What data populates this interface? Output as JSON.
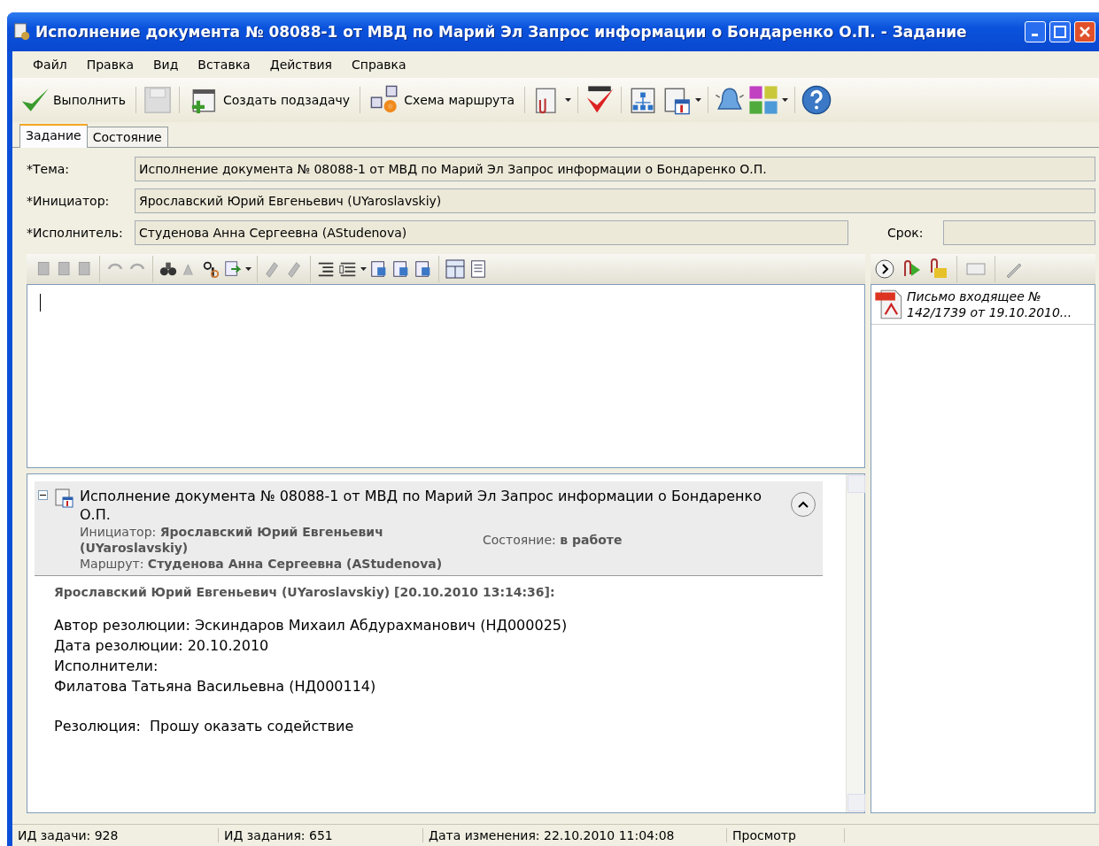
{
  "window": {
    "title": "Исполнение документа № 08088-1 от МВД по Марий Эл Запрос информации о Бондаренко О.П. - Задание"
  },
  "menu": [
    {
      "label": "Файл"
    },
    {
      "label": "Правка"
    },
    {
      "label": "Вид"
    },
    {
      "label": "Вставка"
    },
    {
      "label": "Действия"
    },
    {
      "label": "Справка"
    }
  ],
  "toolbar": {
    "execute": "Выполнить",
    "subtask": "Создать подзадачу",
    "route": "Схема маршрута"
  },
  "tabs": [
    {
      "label": "Задание",
      "selected": true
    },
    {
      "label": "Состояние",
      "selected": false
    }
  ],
  "fields": [
    {
      "label": "*Тема:",
      "value": "Исполнение документа № 08088-1 от МВД по Марий Эл Запрос информации о Бондаренко О.П."
    },
    {
      "label": "*Инициатор:",
      "value": "Ярославский Юрий Евгеньевич (UYaroslavskiy)"
    },
    {
      "label": "*Исполнитель:",
      "value": "Студенова Анна Сергеевна (AStudenova)"
    }
  ],
  "deadline": {
    "label": "Срок:"
  },
  "attachments": [
    {
      "name": "Письмо входящее № 142/1739 от 19.10.2010..."
    }
  ],
  "history": {
    "expanded": true,
    "title": "Исполнение документа № 08088-1 от МВД по Марий Эл Запрос информации о Бондаренко О.П.",
    "initiator_label": "Инициатор:",
    "initiator": "Ярославский Юрий Евгеньевич (UYaroslavskiy)",
    "status_label": "Состояние:",
    "status": "в работе",
    "route_label": "Маршрут:",
    "route": "Студенова Анна Сергеевна (AStudenova)"
  },
  "comment": {
    "header": "Ярославский Юрий Евгеньевич (UYaroslavskiy) [20.10.2010 13:14:36]:",
    "paragraphs": [
      [
        "Автор резолюции: Эскиндаров Михаил Абдурахманович (НД000025)",
        "Дата резолюции: 20.10.2010",
        "Исполнители:",
        "Филатова Татьяна Васильевна (НД000114)"
      ],
      [
        "Резолюция:  Прошу оказать содействие"
      ]
    ]
  },
  "status_bar": [
    "ИД задачи: 928",
    "ИД задания: 651",
    "Дата изменения: 22.10.2010 11:04:08",
    "Просмотр"
  ]
}
